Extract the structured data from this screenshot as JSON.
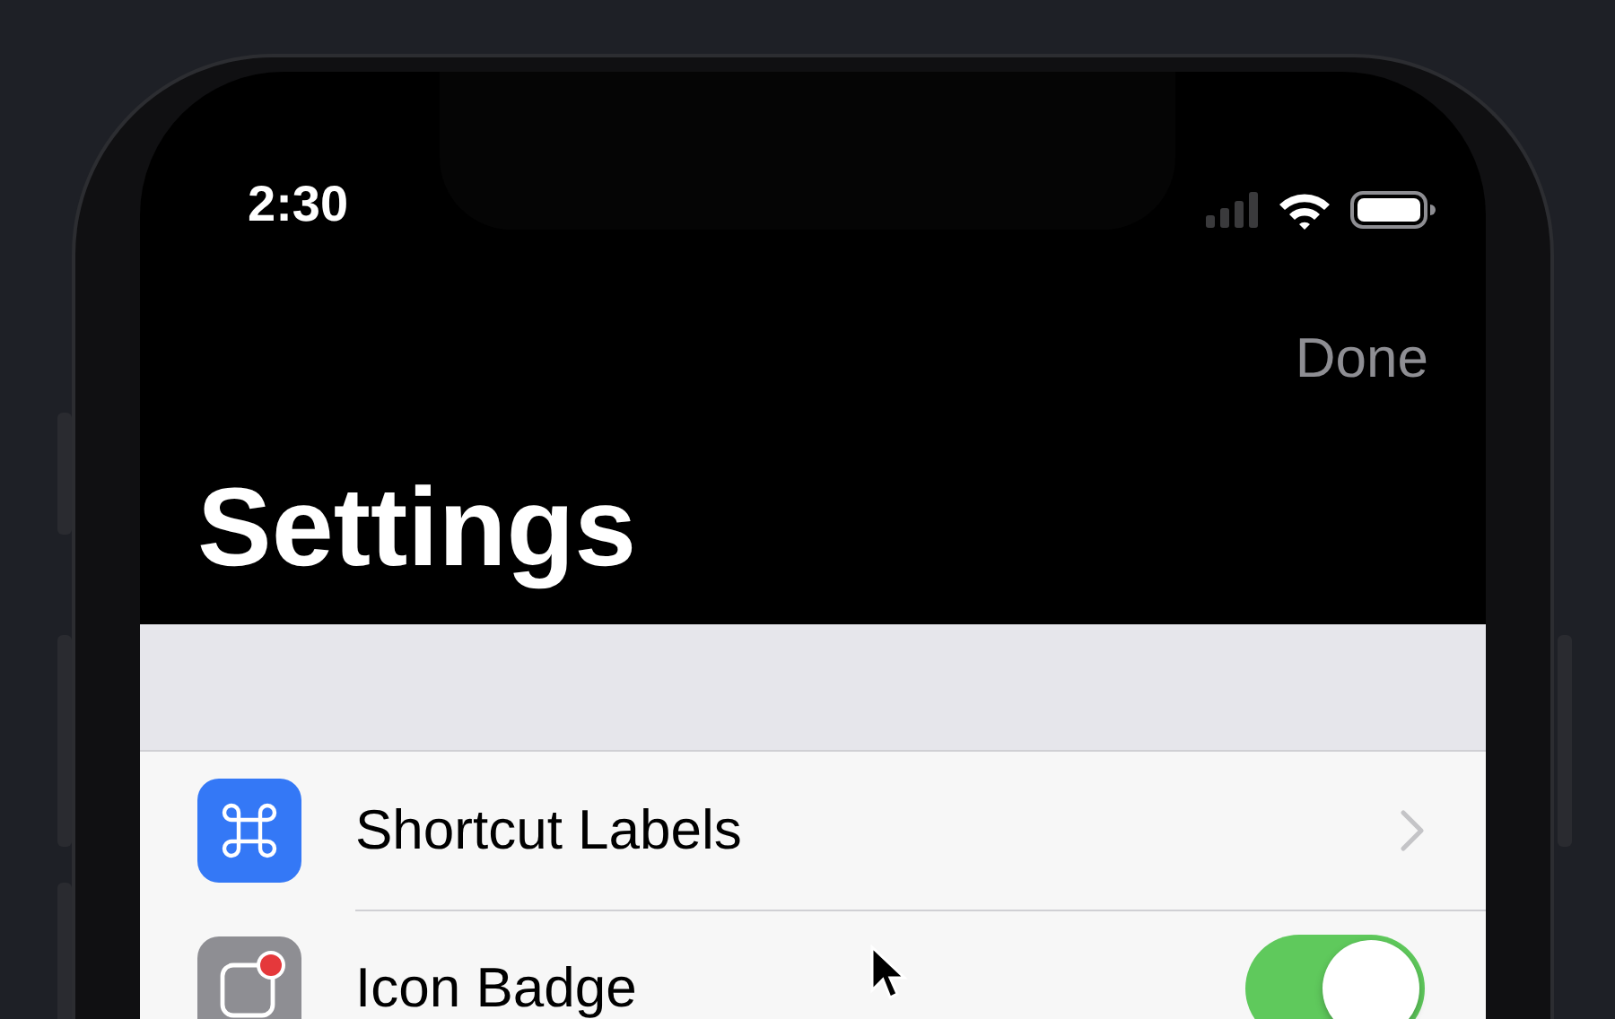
{
  "status_bar": {
    "time": "2:30"
  },
  "nav": {
    "done_button": "Done",
    "title": "Settings"
  },
  "rows": [
    {
      "kind": "link",
      "label": "Shortcut Labels"
    },
    {
      "kind": "toggle",
      "label": "Icon Badge",
      "on": true
    }
  ]
}
